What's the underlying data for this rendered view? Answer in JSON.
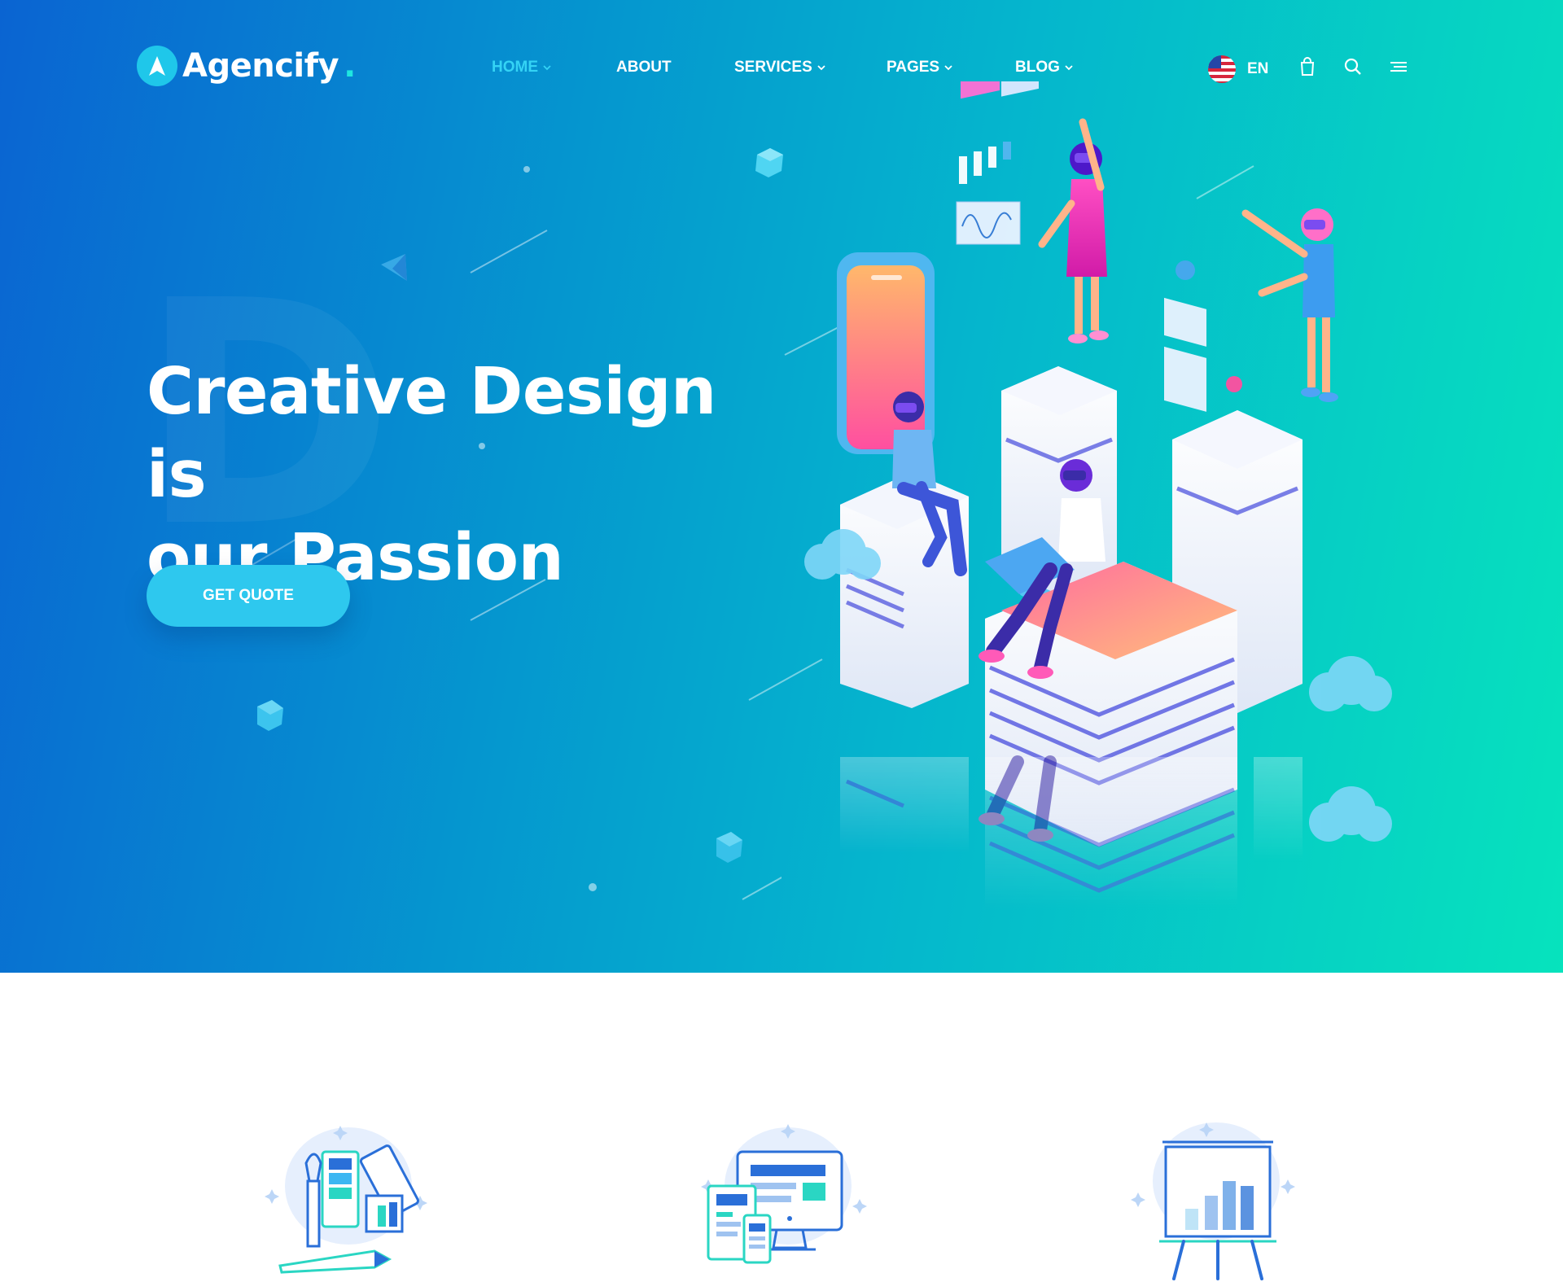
{
  "brand": {
    "name": "Agencify",
    "dot": ".",
    "accent": "#2ec8ee",
    "logo_icon": "arrow-logo-icon"
  },
  "nav": {
    "items": [
      {
        "label": "HOME",
        "dropdown": true,
        "active": true
      },
      {
        "label": "ABOUT",
        "dropdown": false,
        "active": false
      },
      {
        "label": "SERVICES",
        "dropdown": true,
        "active": false
      },
      {
        "label": "PAGES",
        "dropdown": true,
        "active": false
      },
      {
        "label": "BLOG",
        "dropdown": true,
        "active": false
      }
    ],
    "active_color": "#34d3f5"
  },
  "header": {
    "language": "EN",
    "icons": [
      "us-flag-icon",
      "shopping-bag-icon",
      "search-icon",
      "menu-icon"
    ]
  },
  "hero": {
    "title_line1": "Creative Design is",
    "title_line2": "our Passion",
    "cta_label": "GET QUOTE",
    "gradient": [
      "#0a64d2",
      "#05b6cd",
      "#06e3bd"
    ]
  },
  "services": {
    "icons": [
      "design-palette-icon",
      "web-layout-icon",
      "analytics-board-icon"
    ]
  }
}
